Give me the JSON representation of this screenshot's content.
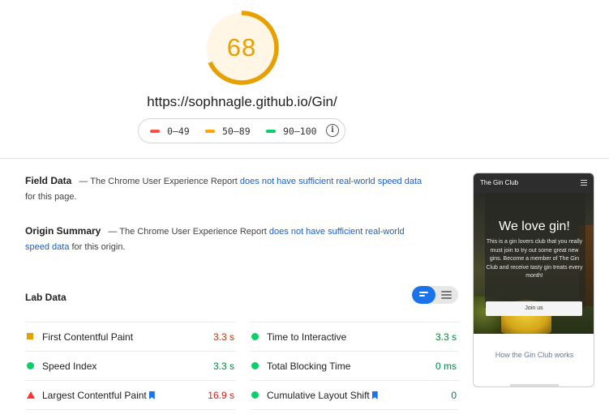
{
  "score": {
    "value": "68",
    "fraction": 0.68,
    "color": "#e8a000",
    "track_color": "#fff6e6"
  },
  "page_url": "https://sophnagle.github.io/Gin/",
  "legend": {
    "items": [
      {
        "range": "0–49",
        "color": "#ff4e42"
      },
      {
        "range": "50–89",
        "color": "#ffa400"
      },
      {
        "range": "90–100",
        "color": "#0cce6b"
      }
    ],
    "info_icon": "info-icon"
  },
  "field_data": {
    "title": "Field Data",
    "prefix": "— The Chrome User Experience Report",
    "link": "does not have sufficient real-world speed data",
    "suffix": "for this page."
  },
  "origin_summary": {
    "title": "Origin Summary",
    "prefix": "— The Chrome User Experience Report",
    "link": "does not have sufficient real-world speed data",
    "suffix": "for this origin."
  },
  "lab_data": {
    "title": "Lab Data",
    "metrics": [
      {
        "name": "First Contentful Paint",
        "value": "3.3 s",
        "status": "average",
        "value_color": "#c33300",
        "icon": "square-icon",
        "bookmark": false
      },
      {
        "name": "Time to Interactive",
        "value": "3.3 s",
        "status": "pass",
        "value_color": "#018642",
        "icon": "circle-icon",
        "bookmark": false
      },
      {
        "name": "Speed Index",
        "value": "3.3 s",
        "status": "pass",
        "value_color": "#018642",
        "icon": "circle-icon",
        "bookmark": false
      },
      {
        "name": "Total Blocking Time",
        "value": "0 ms",
        "status": "pass",
        "value_color": "#018642",
        "icon": "circle-icon",
        "bookmark": false
      },
      {
        "name": "Largest Contentful Paint",
        "value": "16.9 s",
        "status": "fail",
        "value_color": "#c7221f",
        "icon": "triangle-icon",
        "bookmark": true
      },
      {
        "name": "Cumulative Layout Shift",
        "value": "0",
        "status": "pass",
        "value_color": "#018642",
        "icon": "circle-icon",
        "bookmark": true
      }
    ]
  },
  "screenshot": {
    "nav_title": "The Gin Club",
    "hero_title": "We love gin!",
    "hero_text": "This is a gin lovers club that you really must join to try out some great new gins. Become a member of The Gin Club and receive tasty gin treats every month!",
    "button_label": "Join us",
    "subheading": "How the Gin Club works"
  }
}
